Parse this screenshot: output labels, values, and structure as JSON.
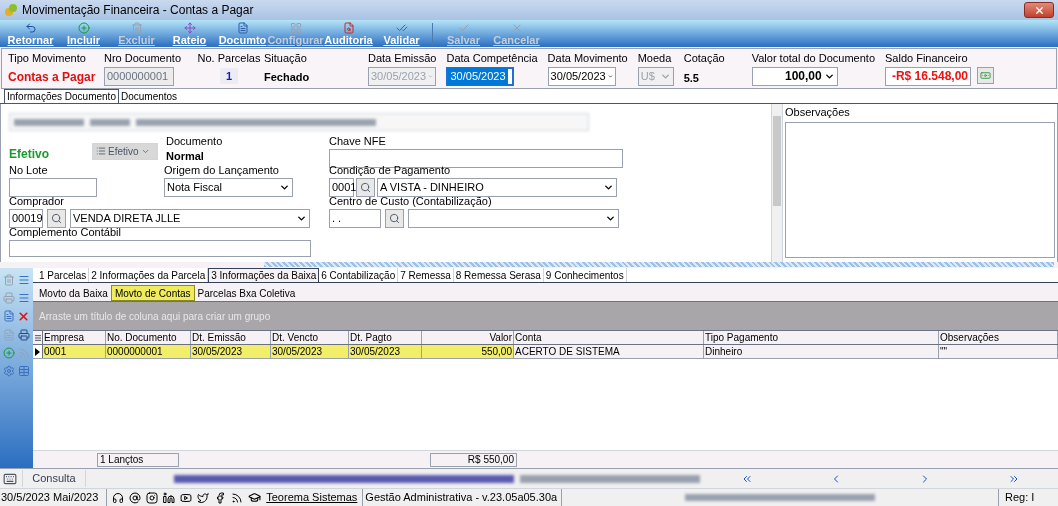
{
  "window": {
    "title": "Movimentação Financeira - Contas a Pagar"
  },
  "toolbar": [
    {
      "label": "Retornar",
      "kind": "back",
      "disabled": false
    },
    {
      "label": "Incluir",
      "kind": "add",
      "disabled": false
    },
    {
      "label": "Excluir",
      "kind": "delete",
      "disabled": true
    },
    {
      "label": "Rateio",
      "kind": "split",
      "disabled": false
    },
    {
      "label": "Documto",
      "kind": "doc",
      "disabled": false
    },
    {
      "label": "Configurar",
      "kind": "config",
      "disabled": true
    },
    {
      "label": "Auditoria",
      "kind": "audit",
      "disabled": false
    },
    {
      "label": "Validar",
      "kind": "validate",
      "disabled": false
    },
    {
      "label": "Salvar",
      "kind": "save",
      "disabled": true
    },
    {
      "label": "Cancelar",
      "kind": "cancel",
      "disabled": true
    }
  ],
  "header": {
    "tipo_movimento": {
      "label": "Tipo Movimento",
      "value": "Contas a Pagar"
    },
    "nro_documento": {
      "label": "Nro Documento",
      "value": "0000000001"
    },
    "no_parcelas": {
      "label": "No. Parcelas",
      "value": "1"
    },
    "situacao": {
      "label": "Situação",
      "value": "Fechado"
    },
    "dates": [
      {
        "label": "Data Emissão",
        "value": "30/05/2023",
        "disabled": true,
        "focused": false
      },
      {
        "label": "Data Competência",
        "value": "30/05/2023",
        "disabled": false,
        "focused": true
      },
      {
        "label": "Data Movimento",
        "value": "30/05/2023",
        "disabled": false,
        "focused": false
      }
    ],
    "moeda": {
      "label": "Moeda",
      "value": "U$"
    },
    "cotacao": {
      "label": "Cotação",
      "value": "5.5"
    },
    "valor_total": {
      "label": "Valor total do Documento",
      "value": "100,00"
    },
    "saldo": {
      "label": "Saldo Financeiro",
      "value": "-R$ 16.548,00"
    }
  },
  "doc_tabs": [
    {
      "label": "Informações Documento",
      "selected": true
    },
    {
      "label": "Documentos",
      "selected": false
    }
  ],
  "form": {
    "status": "Efetivo",
    "status_button": "Efetivo",
    "documento": {
      "label": "Documento",
      "value": "Normal"
    },
    "chave_nfe": {
      "label": "Chave NFE"
    },
    "no_lote": {
      "label": "No Lote"
    },
    "origem": {
      "label": "Origem do Lançamento",
      "value": "Nota Fiscal"
    },
    "condicao": {
      "label": "Condição de Pagamento",
      "code": "0001",
      "value": "A VISTA - DINHEIRO"
    },
    "comprador": {
      "label": "Comprador",
      "code": "00019",
      "value": "VENDA DIRETA JLLE"
    },
    "centro_custo": {
      "label": "Centro de Custo (Contabilização)",
      "code": ". ."
    },
    "complemento": {
      "label": "Complemento Contábil"
    },
    "observacoes": {
      "label": "Observações"
    }
  },
  "lower_tabs": [
    {
      "label": "1 Parcelas",
      "selected": false
    },
    {
      "label": "2 Informações da Parcela",
      "selected": false
    },
    {
      "label": "3 Informações da Baixa",
      "selected": true
    },
    {
      "label": "6 Contabilização",
      "selected": false
    },
    {
      "label": "7 Remessa",
      "selected": false
    },
    {
      "label": "8 Remessa Serasa",
      "selected": false
    },
    {
      "label": "9 Conhecimentos",
      "selected": false
    }
  ],
  "sub_tabs": [
    {
      "label": "Movto da Baixa",
      "selected": false
    },
    {
      "label": "Movto de Contas",
      "selected": true
    },
    {
      "label": "Parcelas Bxa Coletiva",
      "selected": false
    }
  ],
  "group_hint": "Arraste um título de coluna aqui para criar um grupo",
  "table": {
    "columns": [
      {
        "label": "Empresa",
        "numeric": false
      },
      {
        "label": "No. Documento",
        "numeric": false
      },
      {
        "label": "Dt. Emissão",
        "numeric": false
      },
      {
        "label": "Dt. Vencto",
        "numeric": false
      },
      {
        "label": "Dt. Pagto",
        "numeric": false
      },
      {
        "label": "Valor",
        "numeric": true
      },
      {
        "label": "Conta",
        "numeric": false
      },
      {
        "label": "Tipo Pagamento",
        "numeric": false
      },
      {
        "label": "Observações",
        "numeric": false
      }
    ],
    "rows": [
      {
        "selected": true,
        "cells": [
          "0001",
          "0000000001",
          "30/05/2023",
          "30/05/2023",
          "30/05/2023",
          "550,00",
          "ACERTO DE SISTEMA",
          "Dinheiro",
          "\"\""
        ]
      }
    ],
    "totals": [
      "1 Lançtos",
      "R$ 550,00"
    ]
  },
  "status_bar": {
    "mode": "Consulta"
  },
  "footer": {
    "date": "30/5/2023 Mai/2023",
    "company_link": "Teorema Sistemas",
    "version": "Gestão Administrativa - v.23.05a05.30a",
    "reg": "Reg: I"
  }
}
